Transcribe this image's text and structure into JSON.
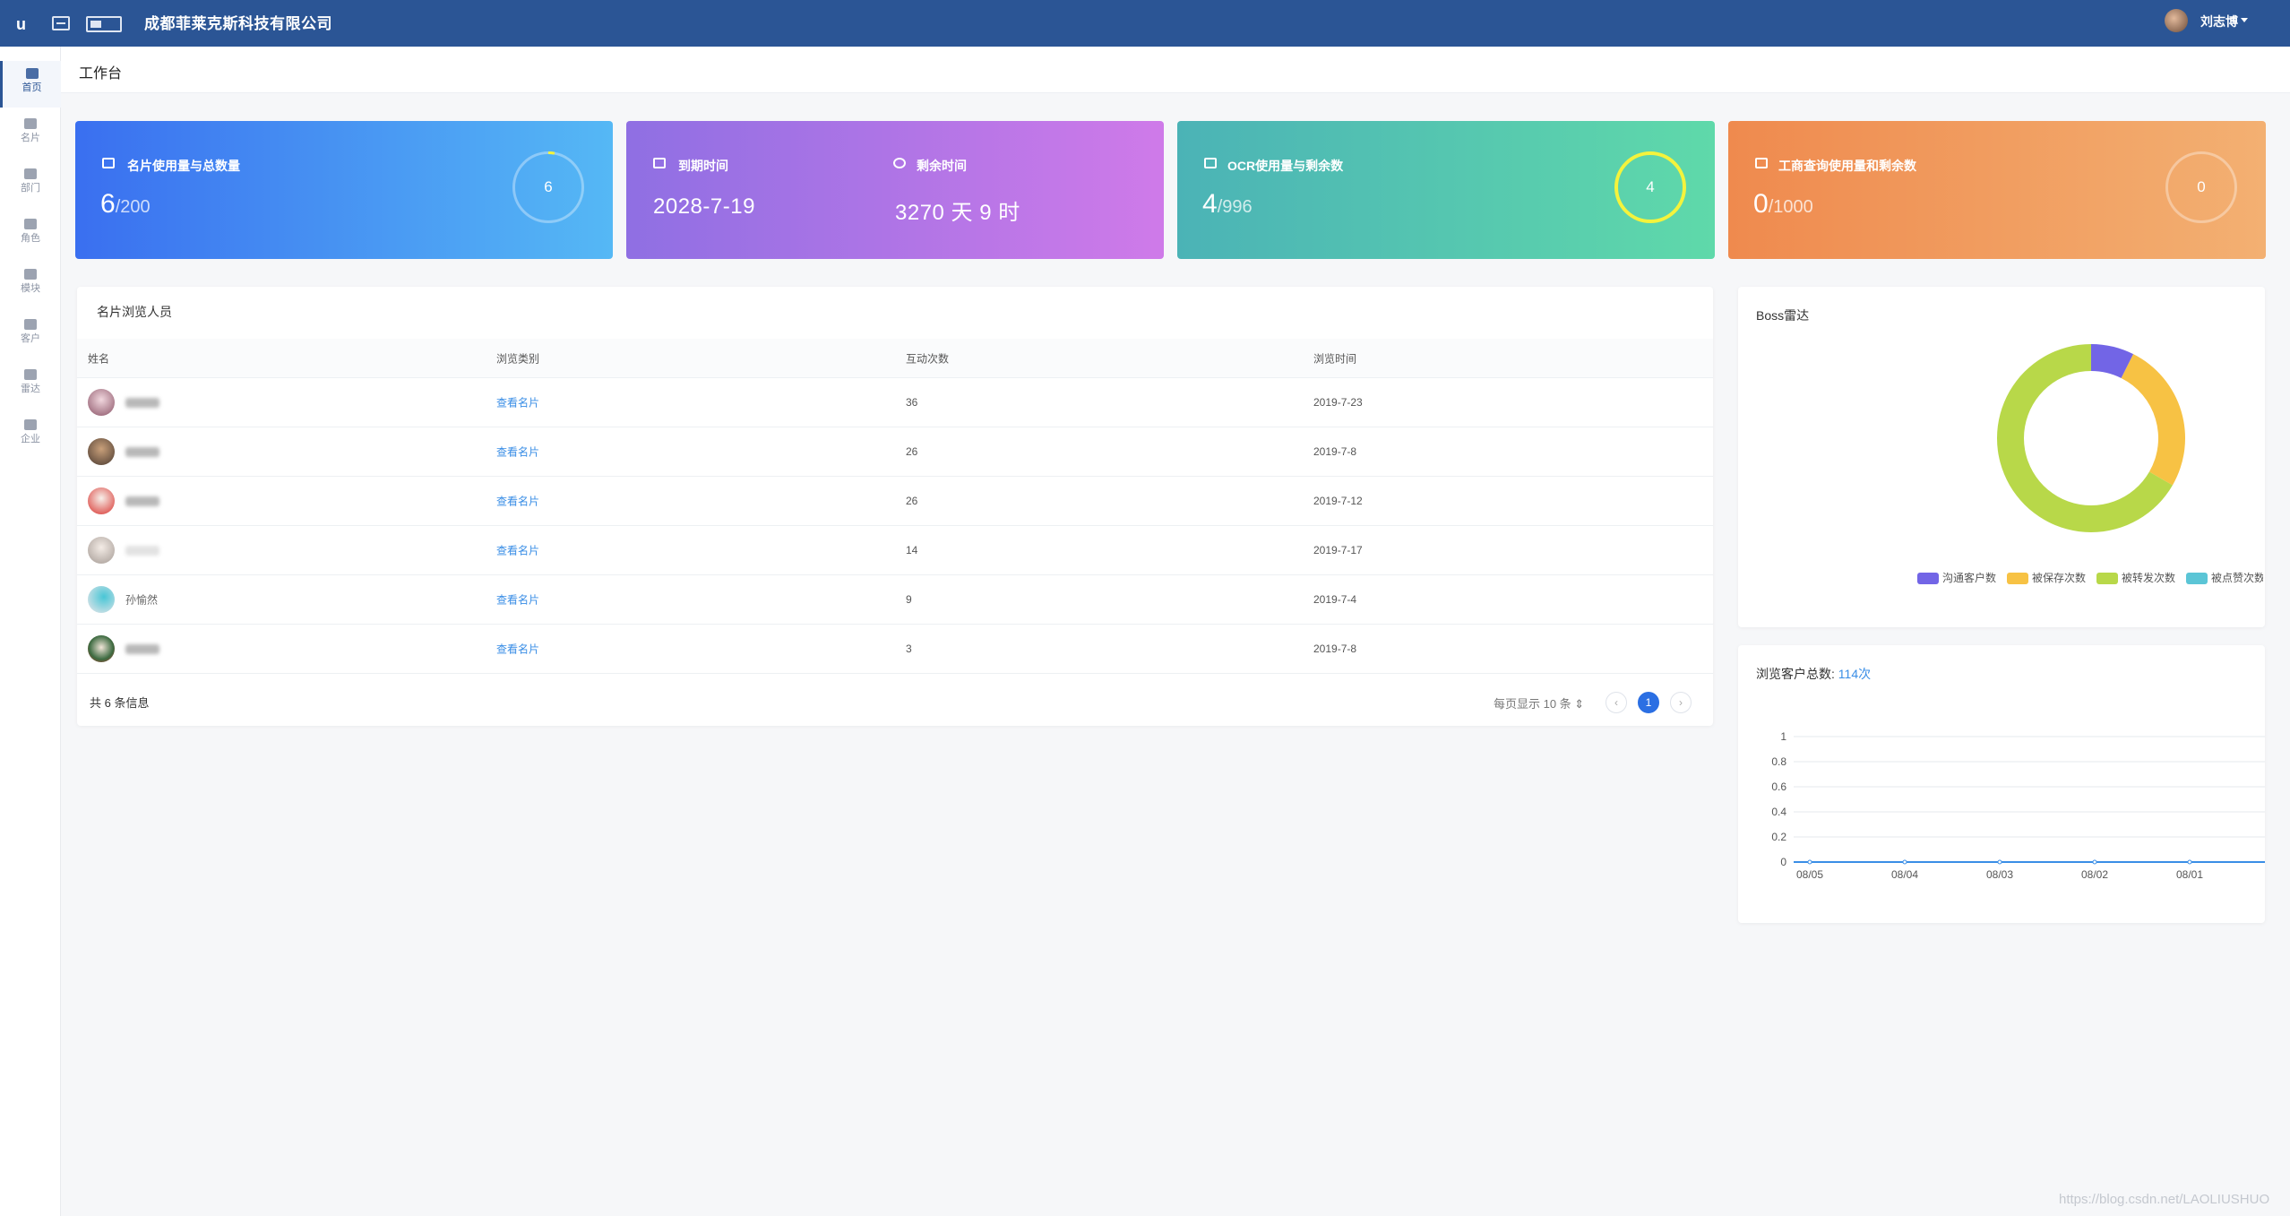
{
  "topbar": {
    "company": "成都菲莱克斯科技有限公司",
    "username": "刘志博"
  },
  "sidebar": {
    "items": [
      {
        "label": "首页",
        "icon": "dashboard-icon",
        "active": true
      },
      {
        "label": "名片",
        "icon": "card-icon"
      },
      {
        "label": "部门",
        "icon": "department-icon"
      },
      {
        "label": "角色",
        "icon": "role-icon"
      },
      {
        "label": "模块",
        "icon": "module-icon"
      },
      {
        "label": "客户",
        "icon": "customer-icon"
      },
      {
        "label": "雷达",
        "icon": "radar-icon"
      },
      {
        "label": "企业",
        "icon": "enterprise-icon"
      }
    ]
  },
  "page": {
    "title": "工作台"
  },
  "stats": {
    "card_usage": {
      "label": "名片使用量与总数量",
      "value": "6",
      "total": "/200",
      "ring": "6"
    },
    "expiry": {
      "label": "到期时间",
      "value": "2028-7-19"
    },
    "remaining": {
      "label": "剩余时间",
      "value": "3270 天 9 时"
    },
    "ocr": {
      "label": "OCR使用量与剩余数",
      "value": "4",
      "total": "/996",
      "ring": "4"
    },
    "business": {
      "label": "工商查询使用量和剩余数",
      "value": "0",
      "total": "/1000",
      "ring": "0"
    }
  },
  "visitors": {
    "title": "名片浏览人员",
    "columns": [
      "姓名",
      "浏览类别",
      "互动次数",
      "浏览时间"
    ],
    "rows": [
      {
        "name": "",
        "category": "查看名片",
        "count": "36",
        "time": "2019-7-23"
      },
      {
        "name": "",
        "category": "查看名片",
        "count": "26",
        "time": "2019-7-8"
      },
      {
        "name": "",
        "category": "查看名片",
        "count": "26",
        "time": "2019-7-12"
      },
      {
        "name": "",
        "category": "查看名片",
        "count": "14",
        "time": "2019-7-17"
      },
      {
        "name": "孙愉然",
        "category": "查看名片",
        "count": "9",
        "time": "2019-7-4"
      },
      {
        "name": "",
        "category": "查看名片",
        "count": "3",
        "time": "2019-7-8"
      }
    ],
    "total_text": "共 6 条信息",
    "per_page": "每页显示 10 条",
    "current_page": "1"
  },
  "radar": {
    "title": "Boss雷达",
    "legend": [
      "沟通客户数",
      "被保存次数",
      "被转发次数",
      "被点赞次数"
    ],
    "colors": [
      "#7265e6",
      "#f7c244",
      "#b8d849",
      "#5bc5d6"
    ],
    "values": [
      10,
      35,
      90,
      0
    ]
  },
  "browse": {
    "title": "浏览客户总数:",
    "total": "114次"
  },
  "chart_data": {
    "type": "line",
    "x": [
      "08/05",
      "08/04",
      "08/03",
      "08/02",
      "08/01"
    ],
    "series": [
      {
        "values": [
          0,
          0,
          0,
          0,
          0
        ]
      }
    ],
    "ylim": [
      0,
      1
    ],
    "yticks": [
      "0",
      "0.2",
      "0.4",
      "0.6",
      "0.8",
      "1"
    ],
    "grid": true,
    "color": "#3a8ee6"
  },
  "watermark": "https://blog.csdn.net/LAOLIUSHUO"
}
